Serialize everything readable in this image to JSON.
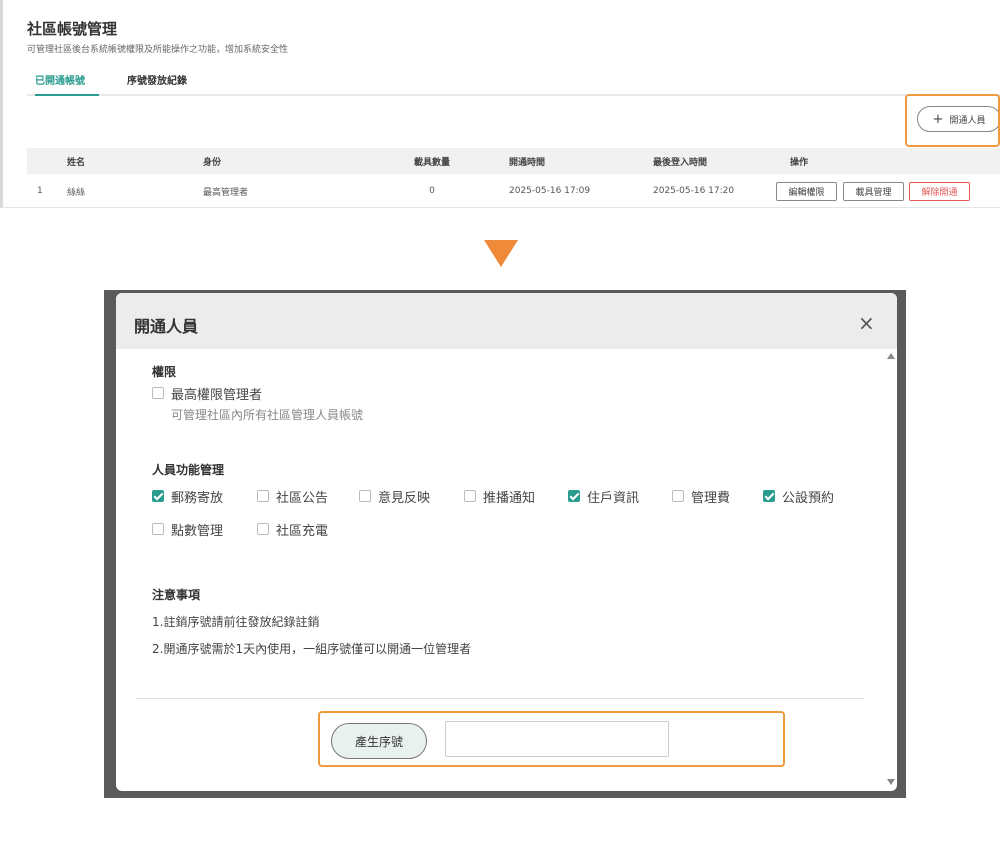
{
  "page": {
    "title": "社區帳號管理",
    "subtitle": "可管理社區後台系統帳號權限及所能操作之功能，增加系統安全性"
  },
  "tabs": [
    {
      "label": "已開通帳號",
      "active": true
    },
    {
      "label": "序號發放紀錄",
      "active": false
    }
  ],
  "toolbar": {
    "add_label": "開通人員",
    "plus_icon": "+"
  },
  "table": {
    "headers": [
      "姓名",
      "身份",
      "載具數量",
      "開通時間",
      "最後登入時間",
      "操作"
    ],
    "rows": [
      {
        "index": "1",
        "name": "絲絲",
        "role": "最高管理者",
        "devices": "0",
        "opened": "2025-05-16 17:09",
        "last_login": "2025-05-16 17:20",
        "actions": [
          "編輯權限",
          "載具管理",
          "解除開通"
        ]
      }
    ]
  },
  "modal": {
    "title": "開通人員",
    "close_icon": "×",
    "permission": {
      "title": "權限",
      "option": {
        "label": "最高權限管理者",
        "checked": false
      },
      "hint": "可管理社區內所有社區管理人員帳號"
    },
    "functions": {
      "title": "人員功能管理",
      "items": [
        {
          "label": "郵務寄放",
          "checked": true
        },
        {
          "label": "社區公告",
          "checked": false
        },
        {
          "label": "意見反映",
          "checked": false
        },
        {
          "label": "推播通知",
          "checked": false
        },
        {
          "label": "住戶資訊",
          "checked": true
        },
        {
          "label": "管理費",
          "checked": false
        },
        {
          "label": "公設預約",
          "checked": true
        },
        {
          "label": "點數管理",
          "checked": false
        },
        {
          "label": "社區充電",
          "checked": false
        }
      ]
    },
    "notes": {
      "title": "注意事項",
      "lines": [
        "1.註銷序號請前往發放紀錄註銷",
        "2.開通序號需於1天內使用，一組序號僅可以開通一位管理者"
      ]
    },
    "generate": {
      "label": "產生序號",
      "value": ""
    }
  },
  "colors": {
    "accent": "#2a9d8f",
    "highlight": "#ef9a3c",
    "arrow": "#ef8a3a",
    "danger": "#e45757"
  }
}
